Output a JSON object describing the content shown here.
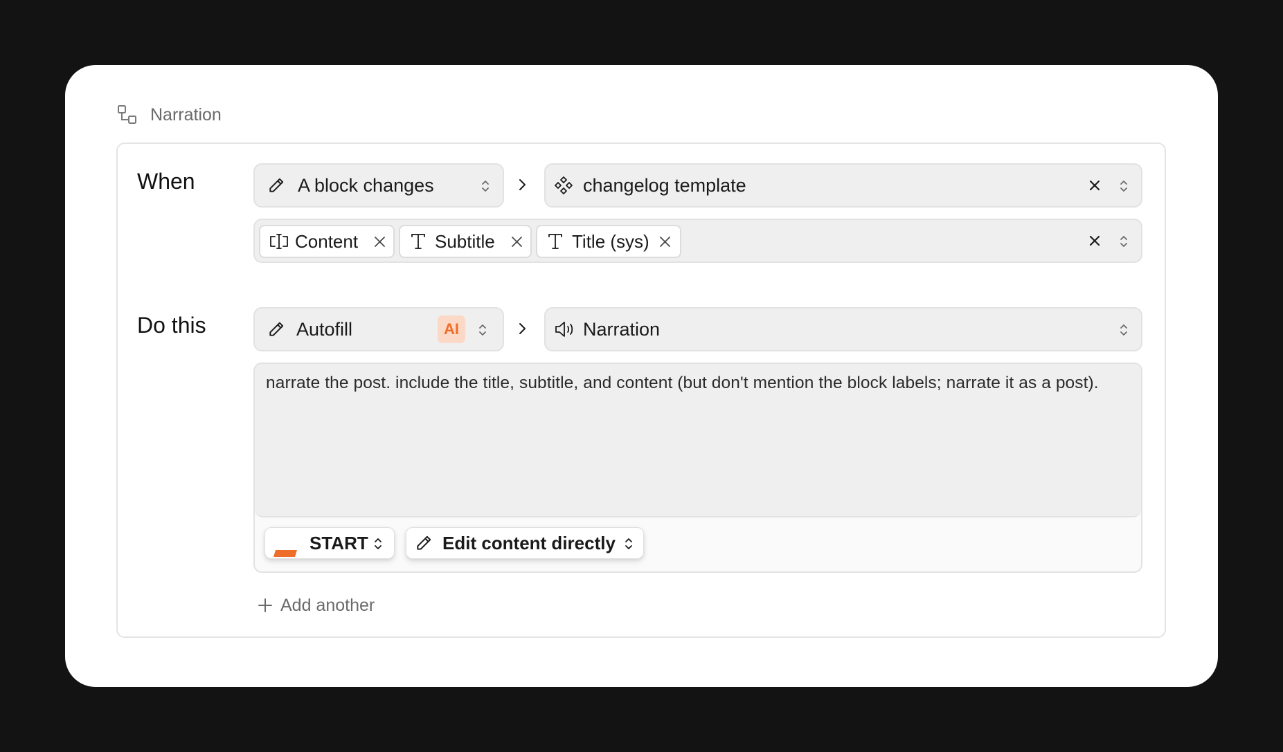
{
  "header": {
    "title": "Narration",
    "icon": "workflow-icon"
  },
  "when": {
    "label": "When",
    "trigger": {
      "value": "A block changes",
      "icon": "pencil-icon"
    },
    "target": {
      "value": "changelog template",
      "icon": "component-icon"
    },
    "fields": [
      {
        "label": "Content",
        "icon": "text-cursor-box-icon"
      },
      {
        "label": "Subtitle",
        "icon": "type-icon"
      },
      {
        "label": "Title (sys)",
        "icon": "type-icon"
      }
    ]
  },
  "do_this": {
    "label": "Do this",
    "action": {
      "value": "Autofill",
      "icon": "pencil-icon",
      "badge": "AI"
    },
    "target": {
      "value": "Narration",
      "icon": "speaker-icon"
    },
    "prompt": "narrate the post. include the title, subtitle, and content (but don't mention the block labels; narrate it as a post).",
    "model": {
      "value": "START",
      "color": "#ef6d2a"
    },
    "mode": {
      "value": "Edit content directly",
      "icon": "pencil-icon"
    }
  },
  "add_another": "Add another",
  "colors": {
    "accent": "#ef6d2a",
    "backdrop": "#131313",
    "card": "#ffffff",
    "field": "#efefef"
  }
}
